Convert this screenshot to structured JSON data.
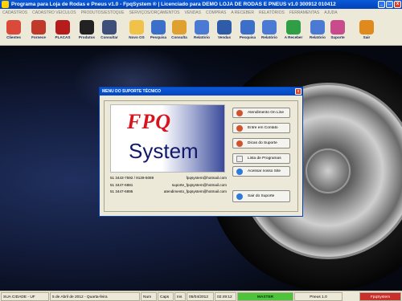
{
  "window": {
    "title": "Programa para Loja de Rodas e Pneus v1.0 - FpqSystem ® | Licenciado para DEMO LOJA DE RODAS E PNEUS v1.0 300912 010412",
    "controls": [
      "_",
      "□",
      "x"
    ]
  },
  "menubar": {
    "items": [
      "CADASTROS",
      "CADASTRO VEICULOS",
      "PRODUTOS/ESTOQUE",
      "SERVIÇOS/ORÇAMENTOS",
      "VENDAS",
      "COMPRAS",
      "A RECEBER",
      "RELATÓRIOS",
      "FERRAMENTAS",
      "AJUDA"
    ]
  },
  "toolbar": {
    "buttons": [
      {
        "label": "Clientes",
        "icon": "person-icon",
        "color": "#d94a3a"
      },
      {
        "label": "Fornece",
        "icon": "supplier-icon",
        "color": "#c0392b"
      },
      {
        "label": "PLACAS",
        "icon": "car-icon",
        "color": "#b71c1c"
      },
      {
        "label": "Produtos",
        "icon": "tire-icon",
        "color": "#222222"
      },
      {
        "label": "Consultar",
        "icon": "list-icon",
        "color": "#3d4f7a"
      },
      {
        "label": "Novo OS",
        "icon": "checklist-icon",
        "color": "#f0c24a"
      },
      {
        "label": "Pesquisa",
        "icon": "search-doc-icon",
        "color": "#3b6fc9"
      },
      {
        "label": "Consulta",
        "icon": "folder-icon",
        "color": "#e0a030"
      },
      {
        "label": "Relatório",
        "icon": "report-icon",
        "color": "#4a7ad4"
      },
      {
        "label": "Vendas",
        "icon": "cart-icon",
        "color": "#2e5ca8"
      },
      {
        "label": "Pesquisa",
        "icon": "search-doc-icon",
        "color": "#3b6fc9"
      },
      {
        "label": "Relatório",
        "icon": "report-icon",
        "color": "#4a7ad4"
      },
      {
        "label": "A Receber",
        "icon": "money-icon",
        "color": "#2f9e44"
      },
      {
        "label": "Relatório",
        "icon": "report-icon",
        "color": "#4a7ad4"
      },
      {
        "label": "Suporte",
        "icon": "support-icon",
        "color": "#c94b8c"
      },
      {
        "label": "Sair",
        "icon": "exit-icon",
        "color": "#e08a1e"
      }
    ]
  },
  "dialog": {
    "title": "MENU DO SUPORTE TÉCNICO",
    "logo_top": "FPQ",
    "logo_bottom": "System",
    "contacts": [
      {
        "phone": "51 3443-7592 / 9139-5089",
        "email": "fpqsystem@hotmail.com"
      },
      {
        "phone": "51 3447-6881",
        "email": "suporte_fpqsystem@hotmail.com"
      },
      {
        "phone": "51 3447-6895",
        "email": "atendimento_fpqsystem@hotmail.com"
      }
    ],
    "buttons": [
      {
        "label": "Atendimento On Line",
        "icon": "chat-icon",
        "color": "#d2522e"
      },
      {
        "label": "Entre em Contato",
        "icon": "contact-icon",
        "color": "#d2522e"
      },
      {
        "label": "Dicas do Suporte",
        "icon": "tips-icon",
        "color": "#d2522e"
      },
      {
        "label": "Lista de Programas",
        "icon": "document-icon",
        "color": "#eeeeee"
      },
      {
        "label": "Acessar nosso Site",
        "icon": "globe-icon",
        "color": "#2f7ad8"
      }
    ],
    "exit_label": "Sair do Suporte"
  },
  "statusbar": {
    "location": "SUA CIDADE - UF",
    "date_long": "5 de Abril de 2012 - Quarta-feira",
    "num": "Num",
    "caps": "Caps",
    "ins": "Ins",
    "date": "05/04/2012",
    "time": "02:49:12",
    "mode": "MASTER",
    "version": "Pneus 1.0",
    "brand": "FpqSystem"
  }
}
